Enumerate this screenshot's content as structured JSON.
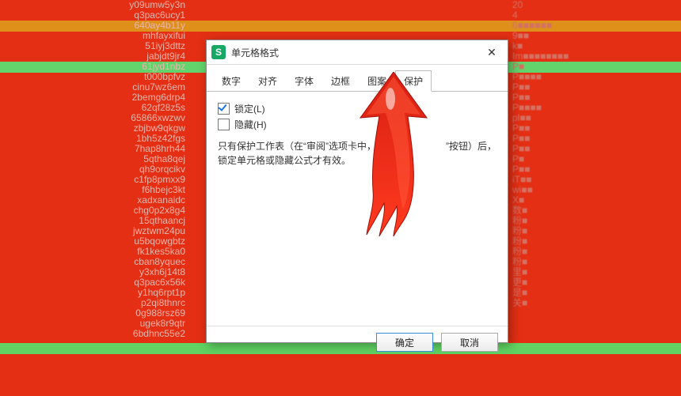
{
  "left_col": [
    "y09umw5y3n",
    "q3pac6ucy1",
    "640ay4b11y",
    "mhfayxifui",
    "51iyj3dttz",
    "jabjdt9jr4",
    "61jyd1nbz",
    "t000bpfvz",
    "cinu7wz6em",
    "2bemg6drp4",
    "62qf28z5s",
    "65866xwzwv",
    "zbjbw9qkgw",
    "1bh5z42fgs",
    "7hap8hrh44",
    "5qtha8qej",
    "qh9orqcikv",
    "c1fp8pmxx9",
    "f6hbejc3kt",
    "xadxanaidc",
    "chg0p2x8g4",
    "15qthaancj",
    "jwztwm24pu",
    "u5bqowgbtz",
    "fk1kes5ka0",
    "cban8yquec",
    "y3xh6j14t8",
    "q3pac6x56k",
    "y1hq6rpt1p",
    "p2qi8thnrc",
    "0g988rsz69",
    "ugek8r9qtr",
    "6bdhnc55e2"
  ],
  "left_hl_idx": [
    2,
    5,
    27
  ],
  "right_col": [
    "20",
    "4",
    "6■■■■■■",
    "9■■",
    "k■",
    "Im■■■■■■■■",
    "P■",
    "P■■■■",
    "P■■",
    "P■■",
    "P■■■■",
    "pl■■",
    "P■■",
    "P■■",
    "P■■",
    "P■",
    "P■■",
    "iT■■",
    "wi■■",
    "X■",
    "数■",
    "粉■",
    "粉■",
    "粉■",
    "粉■",
    "粉■",
    "里■",
    "更■",
    "是■",
    "关■"
  ],
  "dialog": {
    "title": "单元格格式",
    "close": "✕",
    "tabs": [
      "数字",
      "对齐",
      "字体",
      "边框",
      "图案",
      "保护"
    ],
    "active_tab_index": 5,
    "checkbox1": {
      "label": "锁定(L)",
      "checked": true
    },
    "checkbox2": {
      "label": "隐藏(H)",
      "checked": false
    },
    "hint_pre": "只有保护工作表（在“审阅”选项卡中，点击“保",
    "hint_post": "”按钮）后，锁定单元格或隐藏公式才有效。",
    "ok": "确定",
    "cancel": "取消"
  }
}
